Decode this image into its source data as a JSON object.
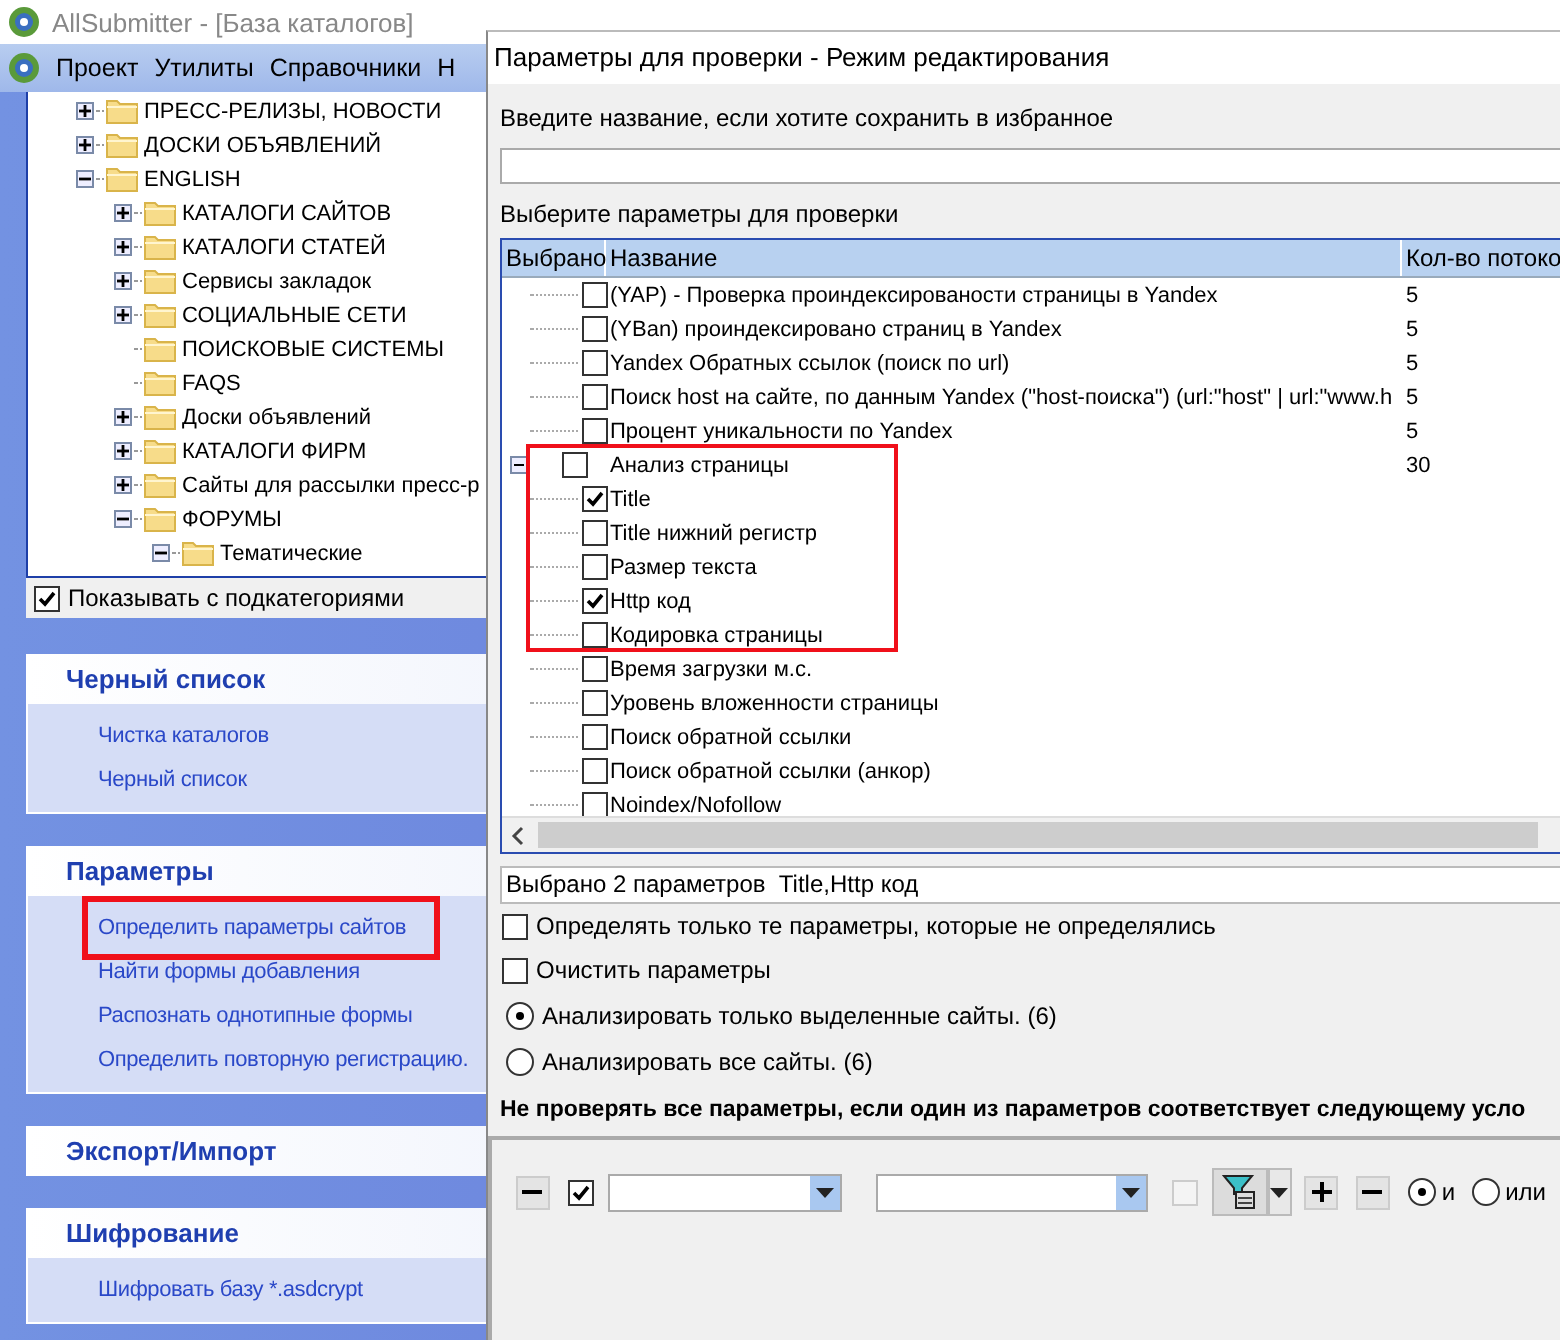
{
  "main_window": {
    "title": "AllSubmitter - [База каталогов]",
    "menu": [
      "Проект",
      "Утилиты",
      "Справочники",
      "Н"
    ],
    "category_tree": [
      {
        "name": "ПРЕСС-РЕЛИЗЫ, НОВОСТИ",
        "expandable": true,
        "expanded": false
      },
      {
        "name": "ДОСКИ ОБЪЯВЛЕНИЙ",
        "expandable": true,
        "expanded": false
      },
      {
        "name": "ENGLISH",
        "expandable": true,
        "expanded": true,
        "children": [
          {
            "name": "КАТАЛОГИ САЙТОВ",
            "expandable": true,
            "expanded": false
          },
          {
            "name": "КАТАЛОГИ СТАТЕЙ",
            "expandable": true,
            "expanded": false
          },
          {
            "name": "Сервисы закладок",
            "expandable": true,
            "expanded": false
          },
          {
            "name": "СОЦИАЛЬНЫЕ СЕТИ",
            "expandable": true,
            "expanded": false
          },
          {
            "name": "ПОИСКОВЫЕ СИСТЕМЫ",
            "expandable": false,
            "expanded": false
          },
          {
            "name": "FAQS",
            "expandable": false,
            "expanded": false
          },
          {
            "name": "Доски объявлений",
            "expandable": true,
            "expanded": false
          },
          {
            "name": "КАТАЛОГИ ФИРМ",
            "expandable": true,
            "expanded": false
          },
          {
            "name": "Сайты для рассылки пресс-р",
            "expandable": true,
            "expanded": false
          },
          {
            "name": "ФОРУМЫ",
            "expandable": true,
            "expanded": true,
            "children": [
              {
                "name": "Тематические",
                "expandable": true,
                "expanded": true
              }
            ]
          }
        ]
      }
    ],
    "show_subcategories": {
      "label": "Показывать с подкатегориями",
      "checked": true
    },
    "task_groups": [
      {
        "title": "Черный список",
        "links": [
          {
            "label": "Чистка каталогов",
            "highlighted": false
          },
          {
            "label": "Черный список",
            "highlighted": false
          }
        ]
      },
      {
        "title": "Параметры",
        "links": [
          {
            "label": "Определить параметры сайтов",
            "highlighted": true
          },
          {
            "label": "Найти формы добавления",
            "highlighted": false
          },
          {
            "label": "Распознать однотипные формы",
            "highlighted": false
          },
          {
            "label": "Определить повторную регистрацию.",
            "highlighted": false
          }
        ]
      },
      {
        "title": "Экспорт/Импорт"
      },
      {
        "title": "Шифрование",
        "links": [
          {
            "label": "Шифровать базу *.asdcrypt",
            "highlighted": false
          }
        ]
      }
    ]
  },
  "dialog": {
    "title": "Параметры для проверки - Режим редактирования",
    "name_label": "Введите название, если хотите сохранить в избранное",
    "params_label": "Выберите параметры для проверки",
    "columns": [
      "Выбрано",
      "Название",
      "Кол-во потоко"
    ],
    "params": [
      {
        "kind": "continued",
        "children": [
          {
            "name": "(YAP) - Проверка проиндексированости страницы в Yandex",
            "checked": false,
            "threads": "5"
          },
          {
            "name": "(YBan) проиндексировано страниц в Yandex",
            "checked": false,
            "threads": "5"
          },
          {
            "name": "Yandex Обратных ссылок  (поиск по url)",
            "checked": false,
            "threads": "5"
          },
          {
            "name": "Поиск host на сайте, по данным Yandex (\"host-поиска\") (url:\"host\" | url:\"www.h",
            "checked": false,
            "threads": "5"
          },
          {
            "name": "Процент уникальности по Yandex",
            "checked": false,
            "threads": "5"
          }
        ]
      },
      {
        "kind": "group",
        "name": "Анализ страницы",
        "checked": false,
        "threads": "30",
        "expanded": true,
        "children": [
          {
            "name": "Title",
            "checked": true
          },
          {
            "name": "Title нижний регистр",
            "checked": false
          },
          {
            "name": "Размер текста",
            "checked": false
          },
          {
            "name": "Http код",
            "checked": true
          },
          {
            "name": "Кодировка страницы",
            "checked": false
          },
          {
            "name": "Время загрузки м.с.",
            "checked": false
          },
          {
            "name": "Уровень вложенности страницы",
            "checked": false
          },
          {
            "name": "Поиск обратной ссылки",
            "checked": false
          },
          {
            "name": "Поиск обратной ссылки (анкор)",
            "checked": false
          },
          {
            "name": "Noindex/Nofollow",
            "checked": false
          }
        ]
      }
    ],
    "summary": "Выбрано 2 параметров  Title,Http код",
    "options": [
      {
        "label": "Определять только те параметры, которые не определялись",
        "checked": false
      },
      {
        "label": "Очистить параметры",
        "checked": false
      }
    ],
    "scope": [
      {
        "label": "Анализировать только выделенные сайты. (6)",
        "selected": true
      },
      {
        "label": "Анализировать все сайты. (6)",
        "selected": false
      }
    ],
    "condition_heading": "Не проверять все параметры, если один из параметров соответствует следующему усло",
    "condition": {
      "checked": true,
      "second_checkbox": {
        "checked": false,
        "disabled": true
      },
      "logic": [
        {
          "label": "и",
          "selected": true
        },
        {
          "label": "или",
          "selected": false
        }
      ]
    }
  }
}
